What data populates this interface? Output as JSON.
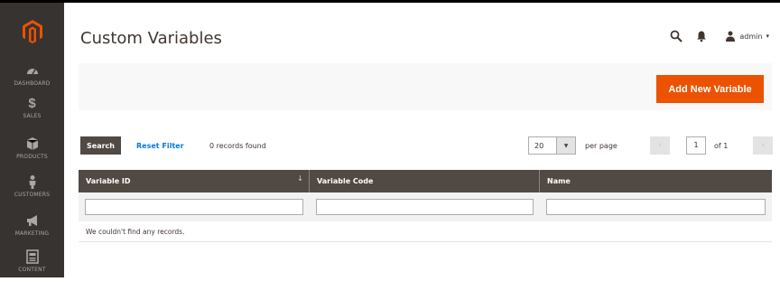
{
  "sidebar": {
    "items": [
      {
        "label": "Dashboard",
        "icon": "dashboard-icon"
      },
      {
        "label": "Sales",
        "icon": "dollar-icon"
      },
      {
        "label": "Products",
        "icon": "cube-icon"
      },
      {
        "label": "Customers",
        "icon": "person-icon"
      },
      {
        "label": "Marketing",
        "icon": "megaphone-icon"
      },
      {
        "label": "Content",
        "icon": "content-icon"
      }
    ]
  },
  "header": {
    "title": "Custom Variables",
    "user": "admin"
  },
  "actions": {
    "add_label": "Add New Variable"
  },
  "grid": {
    "search_label": "Search",
    "reset_label": "Reset Filter",
    "records_found": "0 records found",
    "per_page_value": "20",
    "per_page_label": "per page",
    "current_page": "1",
    "total_pages": "of 1",
    "columns": [
      "Variable ID",
      "Variable Code",
      "Name"
    ],
    "empty_message": "We couldn't find any records."
  },
  "colors": {
    "sidebar": "#373330",
    "accent": "#eb5202",
    "grid_header": "#514943",
    "link": "#007bdb"
  }
}
